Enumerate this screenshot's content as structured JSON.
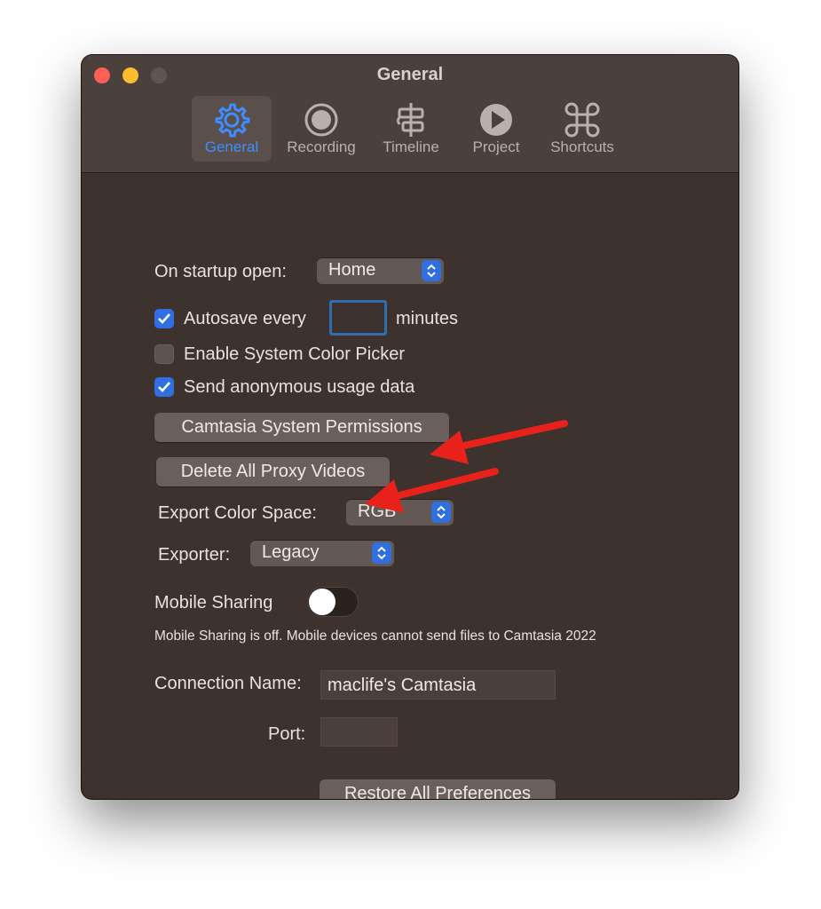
{
  "window": {
    "title": "General"
  },
  "tabs": [
    {
      "label": "General",
      "icon": "gear-icon",
      "active": true
    },
    {
      "label": "Recording",
      "icon": "record-icon",
      "active": false
    },
    {
      "label": "Timeline",
      "icon": "timeline-icon",
      "active": false
    },
    {
      "label": "Project",
      "icon": "play-icon",
      "active": false
    },
    {
      "label": "Shortcuts",
      "icon": "command-icon",
      "active": false
    }
  ],
  "general": {
    "startup_label": "On startup open:",
    "startup_value": "Home",
    "autosave_label": "Autosave every",
    "autosave_value": "",
    "autosave_unit": "minutes",
    "autosave_checked": true,
    "color_picker_label": "Enable System Color Picker",
    "color_picker_checked": false,
    "usage_label": "Send anonymous usage data",
    "usage_checked": true,
    "permissions_button": "Camtasia System Permissions",
    "proxy_button": "Delete All Proxy Videos",
    "color_space_label": "Export Color Space:",
    "color_space_value": "RGB",
    "exporter_label": "Exporter:",
    "exporter_value": "Legacy",
    "mobile_label": "Mobile Sharing",
    "mobile_enabled": false,
    "mobile_status": "Mobile Sharing is off. Mobile devices cannot send files to Camtasia 2022",
    "connection_label": "Connection Name:",
    "connection_value": "maclife's Camtasia",
    "port_label": "Port:",
    "port_value": "",
    "restore_button": "Restore All Preferences"
  },
  "colors": {
    "accent": "#2f6fe0",
    "active_tab_text": "#3f8eff",
    "annotation_arrow": "#e8211a",
    "window_bg": "#3d322e"
  }
}
